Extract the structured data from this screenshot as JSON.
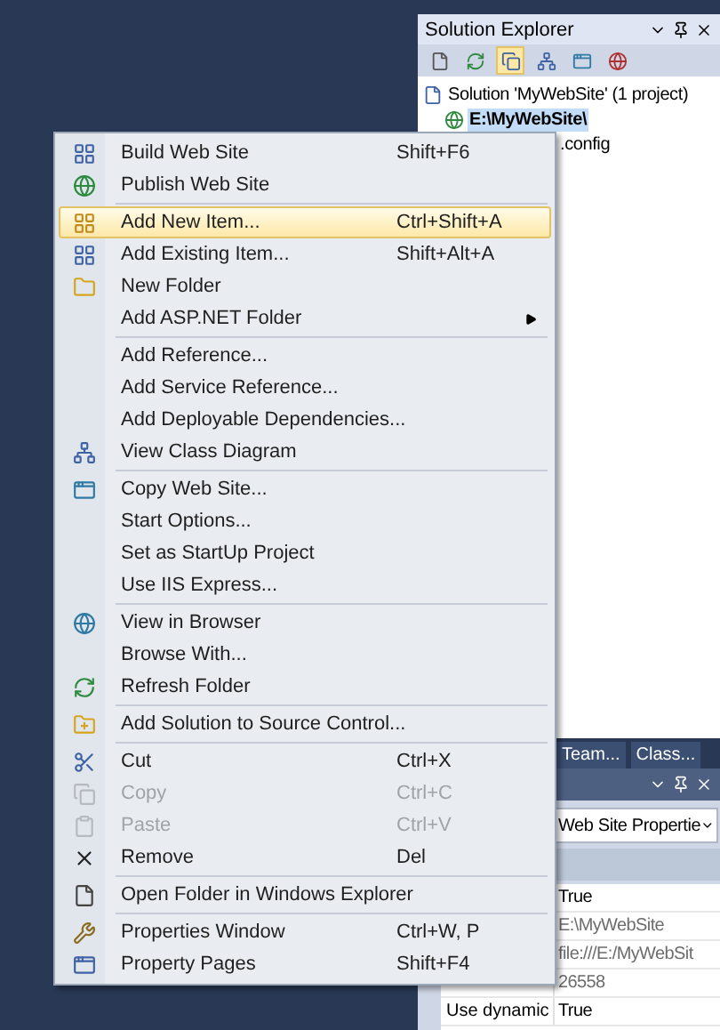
{
  "solution_explorer": {
    "title": "Solution Explorer",
    "tree": [
      {
        "label": "Solution 'MyWebSite' (1 project)",
        "selected": false,
        "children": [
          {
            "label": "E:\\MyWebSite\\",
            "selected": true,
            "children": [
              {
                "label": ".config",
                "selected": false
              }
            ]
          }
        ]
      }
    ]
  },
  "context_menu": {
    "groups": [
      [
        {
          "label": "Build Web Site",
          "shortcut": "Shift+F6",
          "selected": false,
          "disabled": false,
          "submenu": false
        },
        {
          "label": "Publish Web Site",
          "selected": false,
          "disabled": false,
          "submenu": false
        }
      ],
      [
        {
          "label": "Add New Item...",
          "shortcut": "Ctrl+Shift+A",
          "selected": true,
          "disabled": false,
          "submenu": false
        },
        {
          "label": "Add Existing Item...",
          "shortcut": "Shift+Alt+A",
          "selected": false,
          "disabled": false,
          "submenu": false
        },
        {
          "label": "New Folder",
          "selected": false,
          "disabled": false,
          "submenu": false
        },
        {
          "label": "Add ASP.NET Folder",
          "selected": false,
          "disabled": false,
          "submenu": true
        }
      ],
      [
        {
          "label": "Add Reference...",
          "selected": false,
          "disabled": false,
          "submenu": false
        },
        {
          "label": "Add Service Reference...",
          "selected": false,
          "disabled": false,
          "submenu": false
        },
        {
          "label": "Add Deployable Dependencies...",
          "selected": false,
          "disabled": false,
          "submenu": false
        },
        {
          "label": "View Class Diagram",
          "selected": false,
          "disabled": false,
          "submenu": false
        }
      ],
      [
        {
          "label": "Copy Web Site...",
          "selected": false,
          "disabled": false,
          "submenu": false
        },
        {
          "label": "Start Options...",
          "selected": false,
          "disabled": false,
          "submenu": false
        },
        {
          "label": "Set as StartUp Project",
          "selected": false,
          "disabled": false,
          "submenu": false
        },
        {
          "label": "Use IIS Express...",
          "selected": false,
          "disabled": false,
          "submenu": false
        }
      ],
      [
        {
          "label": "View in Browser",
          "selected": false,
          "disabled": false,
          "submenu": false
        },
        {
          "label": "Browse With...",
          "selected": false,
          "disabled": false,
          "submenu": false
        },
        {
          "label": "Refresh Folder",
          "selected": false,
          "disabled": false,
          "submenu": false
        }
      ],
      [
        {
          "label": "Add Solution to Source Control...",
          "selected": false,
          "disabled": false,
          "submenu": false
        }
      ],
      [
        {
          "label": "Cut",
          "shortcut": "Ctrl+X",
          "selected": false,
          "disabled": false,
          "submenu": false
        },
        {
          "label": "Copy",
          "shortcut": "Ctrl+C",
          "selected": false,
          "disabled": true,
          "submenu": false
        },
        {
          "label": "Paste",
          "shortcut": "Ctrl+V",
          "selected": false,
          "disabled": true,
          "submenu": false
        },
        {
          "label": "Remove",
          "shortcut": "Del",
          "selected": false,
          "disabled": false,
          "submenu": false
        }
      ],
      [
        {
          "label": "Open Folder in Windows Explorer",
          "selected": false,
          "disabled": false,
          "submenu": false
        }
      ],
      [
        {
          "label": "Properties Window",
          "shortcut": "Ctrl+W, P",
          "selected": false,
          "disabled": false,
          "submenu": false
        },
        {
          "label": "Property Pages",
          "shortcut": "Shift+F4",
          "selected": false,
          "disabled": false,
          "submenu": false
        }
      ]
    ]
  },
  "doc_tabs": [
    {
      "label": "Team..."
    },
    {
      "label": "Class..."
    }
  ],
  "properties": {
    "object_selector": "Web Site Propertie",
    "rows": [
      {
        "value": "True",
        "disabled": false
      },
      {
        "value": "E:\\MyWebSite",
        "disabled": true
      },
      {
        "value": "file:///E:/MyWebSit",
        "disabled": true
      },
      {
        "value": "26558",
        "disabled": true
      },
      {
        "name": "Use dynamic",
        "value": "True",
        "disabled": false
      }
    ]
  }
}
